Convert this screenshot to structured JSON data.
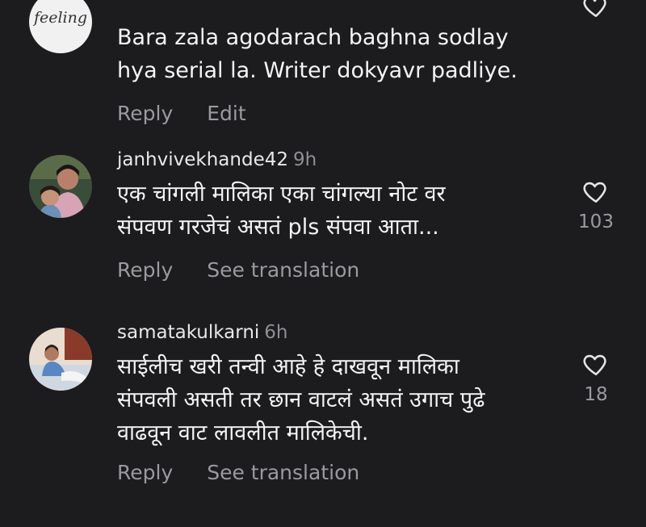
{
  "comments": [
    {
      "avatar_text": "feeling",
      "username": "",
      "time": "",
      "text": "Bara zala agodarach baghna sodlay\nhya serial la. Writer dokyavr padliye.",
      "actions": [
        "Reply",
        "Edit"
      ],
      "like_count": ""
    },
    {
      "username": "janhvivekhande42",
      "time": "9h",
      "text": "एक चांगली मालिका एका चांगल्या नोट वर\nसंपवण गरजेचं असतं pls संपवा आता...",
      "actions": [
        "Reply",
        "See translation"
      ],
      "like_count": "103"
    },
    {
      "username": "samatakulkarni",
      "time": "6h",
      "text": "साईलीच खरी तन्वी आहे हे दाखवून मालिका\nसंपवली असती तर छान वाटलं असतं उगाच पुढे\nवाढवून वाट लावलीत मालिकेची.",
      "actions": [
        "Reply",
        "See translation"
      ],
      "like_count": "18"
    }
  ],
  "colors": {
    "background": "#1c1c1e",
    "secondary_text": "#9a9a9f"
  },
  "icons": {
    "like": "heart-outline-icon"
  }
}
